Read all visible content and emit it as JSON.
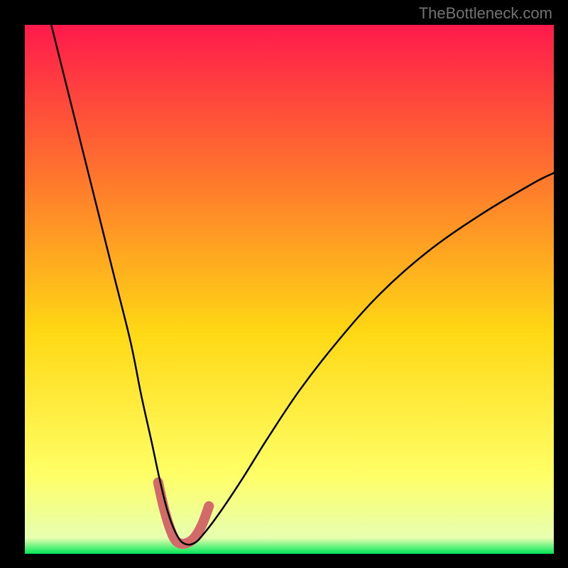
{
  "watermark": "TheBottleneck.com",
  "chart_data": {
    "type": "line",
    "title": "",
    "xlabel": "",
    "ylabel": "",
    "xlim": [
      0,
      100
    ],
    "ylim": [
      0,
      100
    ],
    "grid": false,
    "background_gradient": {
      "top": "#ff1a4b",
      "mid1": "#ff7a2c",
      "mid2": "#ffd814",
      "mid3": "#ffff66",
      "bottom": "#00e756"
    },
    "series": [
      {
        "name": "bottleneck-curve",
        "type": "line",
        "color": "#000000",
        "x": [
          5,
          8,
          11,
          14,
          17,
          20,
          22,
          24,
          25.5,
          27,
          28.5,
          30,
          32,
          34,
          37,
          41,
          46,
          52,
          59,
          67,
          76,
          86,
          96,
          100
        ],
        "y": [
          100,
          88,
          76,
          64,
          52,
          40,
          30,
          21,
          14,
          8,
          4,
          2,
          2,
          4,
          8,
          14,
          22,
          31,
          40,
          49,
          57,
          64,
          70,
          72
        ]
      },
      {
        "name": "optimal-zone-marker",
        "type": "line",
        "color": "#d26a6a",
        "stroke_width_px": 14,
        "x": [
          25.2,
          26.2,
          27.2,
          28.2,
          29.2,
          30.5,
          32.0,
          33.5,
          34.8
        ],
        "y": [
          13.5,
          9.0,
          5.5,
          3.0,
          2.0,
          2.0,
          3.0,
          5.5,
          9.0
        ]
      }
    ],
    "note": "Axes have no visible tick labels; x and y values are normalized 0–100 over the plot area (left/bottom = 0)."
  }
}
